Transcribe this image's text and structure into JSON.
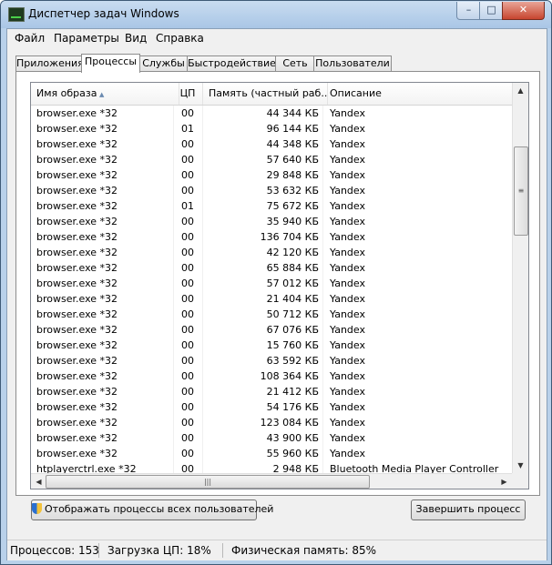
{
  "window": {
    "title": "Диспетчер задач Windows",
    "controls": {
      "minimize": "–",
      "maximize": "□",
      "close": "✕"
    }
  },
  "menu": [
    "Файл",
    "Параметры",
    "Вид",
    "Справка"
  ],
  "tabs": [
    "Приложения",
    "Процессы",
    "Службы",
    "Быстродействие",
    "Сеть",
    "Пользователи"
  ],
  "active_tab": "Процессы",
  "table": {
    "columns": [
      "Имя образа",
      "ЦП",
      "Память (частный раб...",
      "Описание"
    ],
    "sort_arrow": "▲",
    "rows": [
      {
        "name": "browser.exe *32",
        "cpu": "00",
        "mem": "44 344 КБ",
        "desc": "Yandex"
      },
      {
        "name": "browser.exe *32",
        "cpu": "01",
        "mem": "96 144 КБ",
        "desc": "Yandex"
      },
      {
        "name": "browser.exe *32",
        "cpu": "00",
        "mem": "44 348 КБ",
        "desc": "Yandex"
      },
      {
        "name": "browser.exe *32",
        "cpu": "00",
        "mem": "57 640 КБ",
        "desc": "Yandex"
      },
      {
        "name": "browser.exe *32",
        "cpu": "00",
        "mem": "29 848 КБ",
        "desc": "Yandex"
      },
      {
        "name": "browser.exe *32",
        "cpu": "00",
        "mem": "53 632 КБ",
        "desc": "Yandex"
      },
      {
        "name": "browser.exe *32",
        "cpu": "01",
        "mem": "75 672 КБ",
        "desc": "Yandex"
      },
      {
        "name": "browser.exe *32",
        "cpu": "00",
        "mem": "35 940 КБ",
        "desc": "Yandex"
      },
      {
        "name": "browser.exe *32",
        "cpu": "00",
        "mem": "136 704 КБ",
        "desc": "Yandex"
      },
      {
        "name": "browser.exe *32",
        "cpu": "00",
        "mem": "42 120 КБ",
        "desc": "Yandex"
      },
      {
        "name": "browser.exe *32",
        "cpu": "00",
        "mem": "65 884 КБ",
        "desc": "Yandex"
      },
      {
        "name": "browser.exe *32",
        "cpu": "00",
        "mem": "57 012 КБ",
        "desc": "Yandex"
      },
      {
        "name": "browser.exe *32",
        "cpu": "00",
        "mem": "21 404 КБ",
        "desc": "Yandex"
      },
      {
        "name": "browser.exe *32",
        "cpu": "00",
        "mem": "50 712 КБ",
        "desc": "Yandex"
      },
      {
        "name": "browser.exe *32",
        "cpu": "00",
        "mem": "67 076 КБ",
        "desc": "Yandex"
      },
      {
        "name": "browser.exe *32",
        "cpu": "00",
        "mem": "15 760 КБ",
        "desc": "Yandex"
      },
      {
        "name": "browser.exe *32",
        "cpu": "00",
        "mem": "63 592 КБ",
        "desc": "Yandex"
      },
      {
        "name": "browser.exe *32",
        "cpu": "00",
        "mem": "108 364 КБ",
        "desc": "Yandex"
      },
      {
        "name": "browser.exe *32",
        "cpu": "00",
        "mem": "21 412 КБ",
        "desc": "Yandex"
      },
      {
        "name": "browser.exe *32",
        "cpu": "00",
        "mem": "54 176 КБ",
        "desc": "Yandex"
      },
      {
        "name": "browser.exe *32",
        "cpu": "00",
        "mem": "123 084 КБ",
        "desc": "Yandex"
      },
      {
        "name": "browser.exe *32",
        "cpu": "00",
        "mem": "43 900 КБ",
        "desc": "Yandex"
      },
      {
        "name": "browser.exe *32",
        "cpu": "00",
        "mem": "55 960 КБ",
        "desc": "Yandex"
      },
      {
        "name": "htplayerctrl.exe *32",
        "cpu": "00",
        "mem": "2 948 КБ",
        "desc": "Bluetooth Media Player Controller"
      }
    ]
  },
  "scrollbars": {
    "up": "▲",
    "down": "▼",
    "left": "◀",
    "right": "▶",
    "grip_v": "≡",
    "grip_h": "|||"
  },
  "buttons": {
    "show_all": "Отображать процессы всех пользователей",
    "end_process": "Завершить процесс"
  },
  "status": {
    "processes": "Процессов: 153",
    "cpu": "Загрузка ЦП: 18%",
    "memory": "Физическая память: 85%"
  }
}
